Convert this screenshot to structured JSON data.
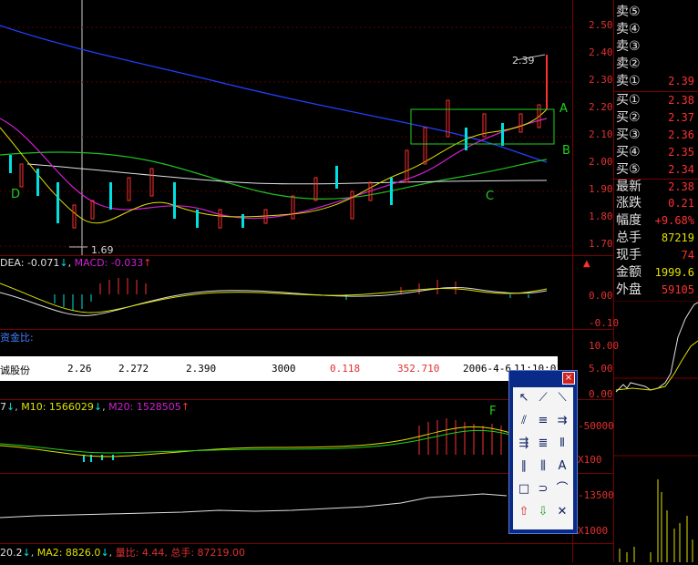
{
  "price_axis": [
    "2.50",
    "2.40",
    "2.30",
    "2.20",
    "2.10",
    "2.00",
    "1.90",
    "1.80",
    "1.70"
  ],
  "macd_axis": [
    "0.05",
    "0.00",
    "-0.10"
  ],
  "vol_axis": [
    "10.00",
    "5.00",
    "0.00"
  ],
  "m_axis": [
    "-50000",
    "X100",
    "-13500",
    "X1000"
  ],
  "annotations": {
    "high": "2.39",
    "low": "1.69",
    "A": "A",
    "B": "B",
    "C": "C",
    "D": "D",
    "F": "F"
  },
  "macd_label": {
    "dea": "DEA: -0.071",
    "macd": "MACD: -0.033",
    "arrow_up": "↑",
    "arrow_down": "↓"
  },
  "capital_label": "资金比:",
  "volume_label": {
    "m5": "7",
    "m10": "M10: 1566029",
    "m20": "M20: 1528505"
  },
  "bottom_label": {
    "ma1": "20.2",
    "ma2": "MA2: 8826.0",
    "ratio": "量比: 4.44,",
    "total": "总手: 87219.00"
  },
  "quote_row": {
    "name": "诚股份",
    "v1": "2.26",
    "v2": "2.272",
    "v3": "2.390",
    "v4": "3000",
    "v5": "0.118",
    "v6": "352.710",
    "date": "2006-4-6",
    "time": "11:10:01"
  },
  "right_panel": [
    {
      "label": "卖⑤",
      "value": ""
    },
    {
      "label": "卖④",
      "value": ""
    },
    {
      "label": "卖③",
      "value": ""
    },
    {
      "label": "卖②",
      "value": ""
    },
    {
      "label": "卖①",
      "value": "2.39"
    },
    {
      "label": "买①",
      "value": "2.38"
    },
    {
      "label": "买②",
      "value": "2.37"
    },
    {
      "label": "买③",
      "value": "2.36"
    },
    {
      "label": "买④",
      "value": "2.35"
    },
    {
      "label": "买⑤",
      "value": "2.34"
    },
    {
      "label": "最新",
      "value": "2.38"
    },
    {
      "label": "涨跌",
      "value": "0.21"
    },
    {
      "label": "幅度",
      "value": "+9.68%"
    },
    {
      "label": "总手",
      "value": "87219"
    },
    {
      "label": "现手",
      "value": "74"
    },
    {
      "label": "金额",
      "value": "1999.6"
    },
    {
      "label": "外盘",
      "value": "59105"
    }
  ],
  "toolbox": {
    "close": "×",
    "tools": [
      "↖",
      "⟋",
      "⟍",
      "⫽",
      "≡",
      "⇉",
      "⇶",
      "≣",
      "⫴",
      "∥",
      "⫼",
      "A",
      "□",
      "⊃",
      "⌒",
      "⇧",
      "⇩",
      "✕"
    ]
  },
  "colors": {
    "up": "#ff3030",
    "down": "#00e0e0",
    "grid": "#7a0000",
    "text": "#e03030"
  }
}
